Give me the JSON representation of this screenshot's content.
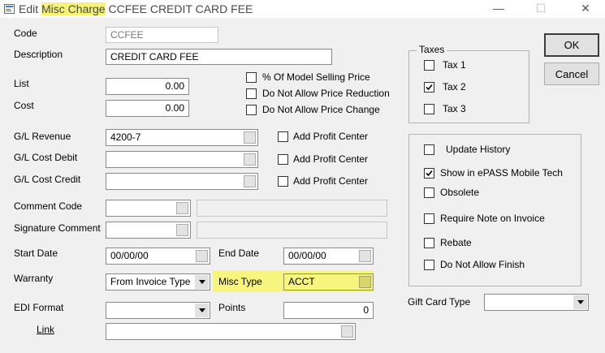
{
  "title": {
    "prefix": "Edit",
    "highlighted": "Misc Charge",
    "suffix": "CCFEE CREDIT CARD FEE"
  },
  "window_controls": {
    "minimize": "—",
    "maximize": "☐",
    "close": "✕"
  },
  "labels": {
    "code": "Code",
    "description": "Description",
    "list": "List",
    "cost": "Cost",
    "gl_revenue": "G/L Revenue",
    "gl_cost_debit": "G/L Cost Debit",
    "gl_cost_credit": "G/L Cost Credit",
    "comment_code": "Comment Code",
    "signature_comment": "Signature Comment",
    "start_date": "Start Date",
    "end_date": "End Date",
    "warranty": "Warranty",
    "misc_type": "Misc Type",
    "edi_format": "EDI Format",
    "points": "Points",
    "link": "Link",
    "gift_card_type": "Gift Card Type"
  },
  "values": {
    "code": "CCFEE",
    "description": "CREDIT CARD FEE",
    "list": "0.00",
    "cost": "0.00",
    "gl_revenue": "4200-7",
    "gl_cost_debit": "",
    "gl_cost_credit": "",
    "comment_code": "",
    "comment_desc": "",
    "signature_comment": "",
    "signature_desc": "",
    "start_date": "00/00/00",
    "end_date": "00/00/00",
    "warranty": "From Invoice Type",
    "misc_type": "ACCT",
    "edi_format": "",
    "points": "0",
    "link": "",
    "gift_card_type": ""
  },
  "price_options": [
    {
      "label": "% Of Model Selling Price",
      "checked": false
    },
    {
      "label": "Do Not Allow Price Reduction",
      "checked": false
    },
    {
      "label": "Do Not Allow Price Change",
      "checked": false
    }
  ],
  "profit_center": [
    {
      "label": "Add Profit Center",
      "checked": false
    },
    {
      "label": "Add Profit Center",
      "checked": false
    },
    {
      "label": "Add Profit Center",
      "checked": false
    }
  ],
  "taxes": {
    "title": "Taxes",
    "items": [
      {
        "label": "Tax 1",
        "checked": false
      },
      {
        "label": "Tax 2",
        "checked": true
      },
      {
        "label": "Tax 3",
        "checked": false
      }
    ]
  },
  "options": [
    {
      "label": "Update History",
      "checked": false
    },
    {
      "label": "Show in ePASS Mobile Tech",
      "checked": true
    },
    {
      "label": "Obsolete",
      "checked": false
    },
    {
      "label": "Require Note on Invoice",
      "checked": false
    },
    {
      "label": "Rebate",
      "checked": false
    },
    {
      "label": "Do Not Allow Finish",
      "checked": false
    }
  ],
  "buttons": {
    "ok": "OK",
    "cancel": "Cancel"
  },
  "colors": {
    "highlight": "#f8f57e",
    "background": "#f0f0f0"
  }
}
